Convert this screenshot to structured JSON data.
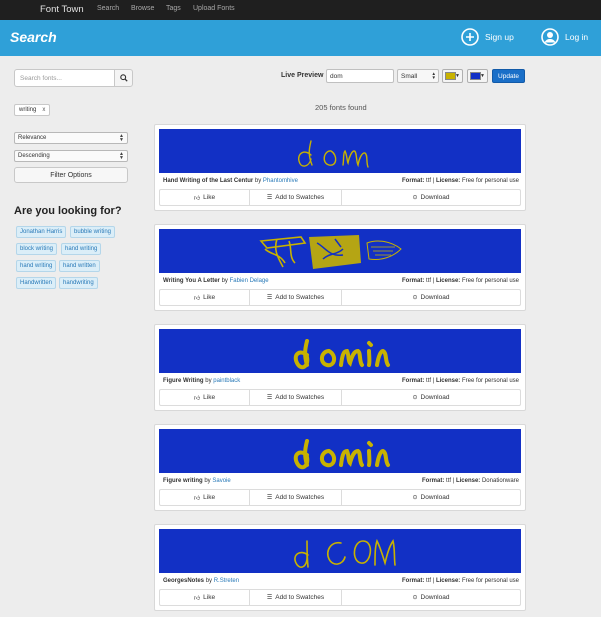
{
  "topbar": {
    "brand": "Font Town",
    "nav": [
      "Search",
      "Browse",
      "Tags",
      "Upload Fonts"
    ]
  },
  "header": {
    "title": "Search",
    "signup_label": "Sign up",
    "login_label": "Log in"
  },
  "sidebar": {
    "search_placeholder": "Search fonts...",
    "active_tag": "writing",
    "tag_remove": "x",
    "sort_by": "Relevance",
    "sort_order": "Descending",
    "filter_button": "Filter Options",
    "looking_for_title": "Are you looking for?",
    "suggestions": [
      "Jonathan Harris",
      "bubble writing",
      "block writing",
      "hand writing",
      "hand writing",
      "hand written",
      "Handwritten",
      "handwriting"
    ]
  },
  "toolbar": {
    "live_preview_label": "Live Preview",
    "preview_text": "dom",
    "size": "Small",
    "text_color": "#c8b200",
    "bg_color": "#1230c5",
    "update_button": "Update"
  },
  "results": {
    "count_text": "205 fonts found",
    "by_label": "by",
    "format_label": "Format:",
    "license_label": "License:",
    "like_label": "Like",
    "swatches_label": "Add to Swatches",
    "download_label": "Download",
    "fonts": [
      {
        "name": "Hand Writing of the Last Centur",
        "author": "Phantomhive",
        "format": "ttf",
        "license": "Free for personal use",
        "style": "hand-thin"
      },
      {
        "name": "Writing You A Letter",
        "author": "Fabien Delage",
        "format": "ttf",
        "license": "Free for personal use",
        "style": "doodle"
      },
      {
        "name": "Figure Writing",
        "author": "paintblack",
        "format": "ttf",
        "license": "Free for personal use",
        "style": "brush"
      },
      {
        "name": "Figure writing",
        "author": "Savoie",
        "format": "ttf",
        "license": "Donationware",
        "style": "brush"
      },
      {
        "name": "GeorgesNotes",
        "author": "R.Streten",
        "format": "ttf",
        "license": "Free for personal use",
        "style": "hand-caps"
      }
    ]
  }
}
